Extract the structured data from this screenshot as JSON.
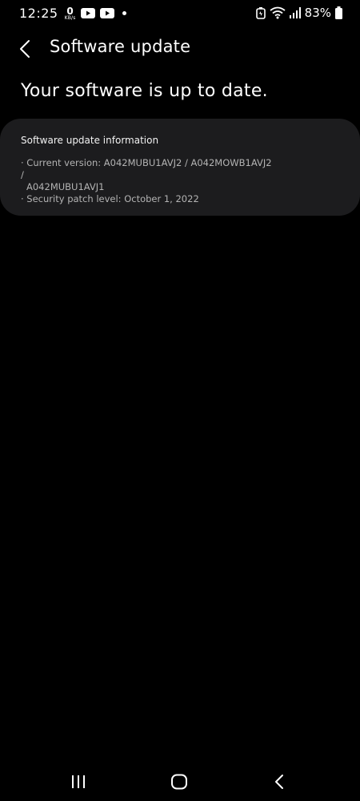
{
  "status_bar": {
    "time": "12:25",
    "net_speed_value": "0",
    "net_speed_unit": "KB/s",
    "battery_percent": "83%",
    "icons": [
      "youtube-icon",
      "youtube-icon",
      "notification-dot",
      "battery-saver-icon",
      "wifi-icon",
      "signal-icon",
      "battery-icon"
    ]
  },
  "header": {
    "title": "Software update"
  },
  "main": {
    "heading": "Your software is up to date.",
    "info_card": {
      "title": "Software update information",
      "current_version_line1": "· Current version: A042MUBU1AVJ2 / A042MOWB1AVJ2 /",
      "current_version_line2": "A042MUBU1AVJ1",
      "security_patch": "· Security patch level: October 1, 2022"
    }
  },
  "nav_bar": {
    "buttons": [
      "recents",
      "home",
      "back"
    ]
  },
  "colors": {
    "background": "#000000",
    "card": "#1c1c1e",
    "primary_text": "#ffffff",
    "secondary_text": "#b3b3b3"
  }
}
